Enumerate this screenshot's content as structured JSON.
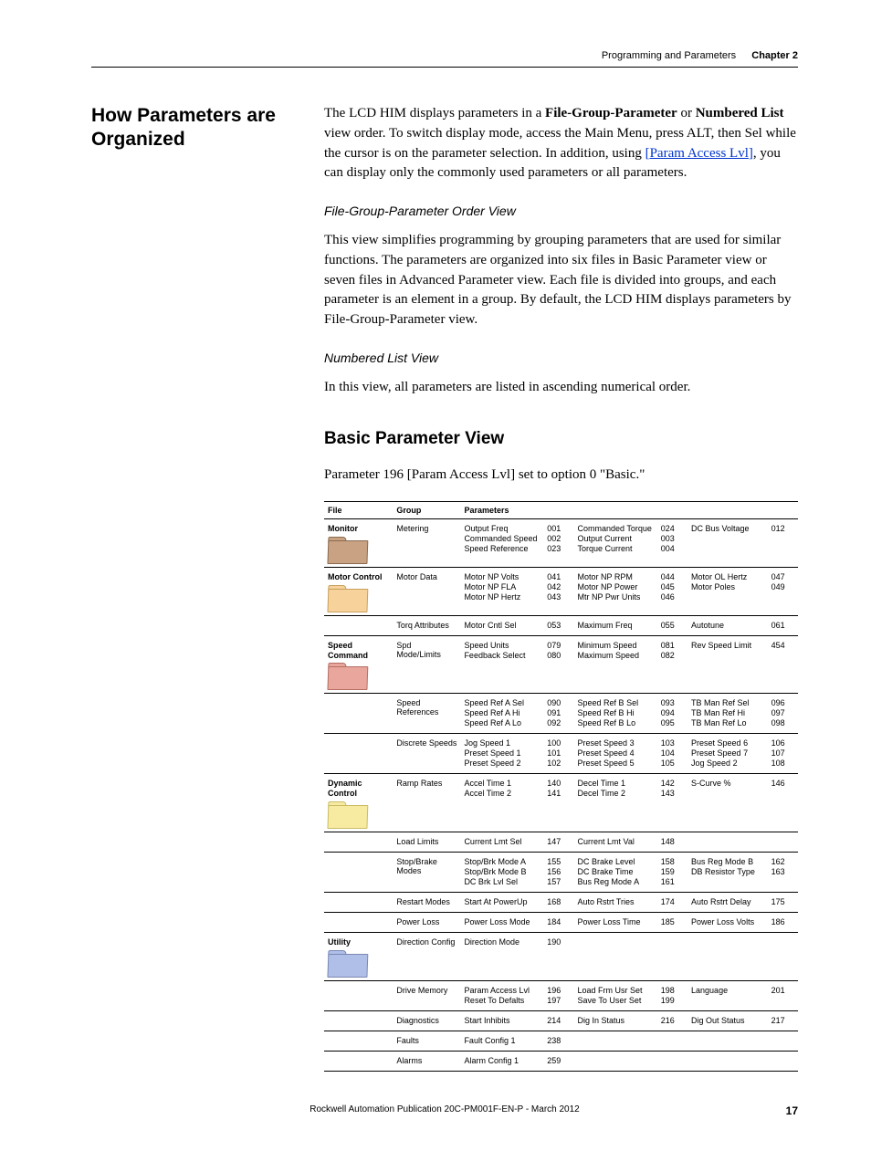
{
  "header": {
    "left": "Programming and Parameters",
    "chapter": "Chapter 2"
  },
  "section_heading": "How Parameters are Organized",
  "intro": {
    "p1a": "The LCD HIM displays parameters in a ",
    "p1_bold1": "File-Group-Parameter",
    "p1b": " or ",
    "p1_bold2": "Numbered List",
    "p1c": " view order. To switch display mode, access the Main Menu, press ALT, then Sel while the cursor is on the parameter selection. In addition, using ",
    "p1_link": "[Param Access Lvl]",
    "p1d": ", you can display only the commonly used parameters or all parameters."
  },
  "sub1_heading": "File-Group-Parameter Order View",
  "sub1_body": "This view simplifies programming by grouping parameters that are used for similar functions. The parameters are organized into six files in Basic Parameter view or seven files in Advanced Parameter view. Each file is divided into groups, and each parameter is an element in a group. By default, the LCD HIM displays parameters by File-Group-Parameter view.",
  "sub2_heading": "Numbered List View",
  "sub2_body": "In this view, all parameters are listed in ascending numerical order.",
  "basic_heading": "Basic Parameter View",
  "basic_caption": "Parameter 196 [Param Access Lvl] set to option 0 \"Basic.\"",
  "table": {
    "headers": {
      "file": "File",
      "group": "Group",
      "params": "Parameters"
    },
    "rows": [
      {
        "sep": "file",
        "file": "Monitor",
        "folder": "f-monitor",
        "group": "Metering",
        "c1": [
          [
            "Output Freq",
            "001"
          ],
          [
            "Commanded Speed",
            "002"
          ],
          [
            "Speed Reference",
            "023"
          ]
        ],
        "c2": [
          [
            "Commanded Torque",
            "024"
          ],
          [
            "Output Current",
            "003"
          ],
          [
            "Torque Current",
            "004"
          ]
        ],
        "c3": [
          [
            "DC Bus Voltage",
            "012"
          ]
        ]
      },
      {
        "sep": "file",
        "file": "Motor Control",
        "folder": "f-motor",
        "group": "Motor Data",
        "c1": [
          [
            "Motor NP Volts",
            "041"
          ],
          [
            "Motor NP FLA",
            "042"
          ],
          [
            "Motor NP Hertz",
            "043"
          ]
        ],
        "c2": [
          [
            "Motor NP RPM",
            "044"
          ],
          [
            "Motor NP Power",
            "045"
          ],
          [
            "Mtr NP Pwr Units",
            "046"
          ]
        ],
        "c3": [
          [
            "Motor OL Hertz",
            "047"
          ],
          [
            "Motor Poles",
            "049"
          ]
        ]
      },
      {
        "sep": "group",
        "file": "",
        "folder": "",
        "group": "Torq Attributes",
        "c1": [
          [
            "Motor Cntl Sel",
            "053"
          ]
        ],
        "c2": [
          [
            "Maximum Freq",
            "055"
          ]
        ],
        "c3": [
          [
            "Autotune",
            "061"
          ]
        ]
      },
      {
        "sep": "file",
        "file": "Speed Command",
        "folder": "f-speed",
        "group": "Spd Mode/Limits",
        "c1": [
          [
            "Speed Units",
            "079"
          ],
          [
            "Feedback Select",
            "080"
          ]
        ],
        "c2": [
          [
            "Minimum Speed",
            "081"
          ],
          [
            "Maximum Speed",
            "082"
          ]
        ],
        "c3": [
          [
            "Rev Speed Limit",
            "454"
          ]
        ]
      },
      {
        "sep": "group",
        "file": "",
        "folder": "",
        "group": "Speed References",
        "c1": [
          [
            "Speed Ref A Sel",
            "090"
          ],
          [
            "Speed Ref A Hi",
            "091"
          ],
          [
            "Speed Ref A Lo",
            "092"
          ]
        ],
        "c2": [
          [
            "Speed Ref B Sel",
            "093"
          ],
          [
            "Speed Ref B Hi",
            "094"
          ],
          [
            "Speed Ref B Lo",
            "095"
          ]
        ],
        "c3": [
          [
            "TB Man Ref Sel",
            "096"
          ],
          [
            "TB Man Ref Hi",
            "097"
          ],
          [
            "TB Man Ref Lo",
            "098"
          ]
        ]
      },
      {
        "sep": "group",
        "file": "",
        "folder": "",
        "group": "Discrete Speeds",
        "c1": [
          [
            "Jog Speed 1",
            "100"
          ],
          [
            "Preset Speed 1",
            "101"
          ],
          [
            "Preset Speed 2",
            "102"
          ]
        ],
        "c2": [
          [
            "Preset Speed 3",
            "103"
          ],
          [
            "Preset Speed 4",
            "104"
          ],
          [
            "Preset Speed 5",
            "105"
          ]
        ],
        "c3": [
          [
            "Preset Speed 6",
            "106"
          ],
          [
            "Preset Speed 7",
            "107"
          ],
          [
            "Jog Speed 2",
            "108"
          ]
        ]
      },
      {
        "sep": "file",
        "file": "Dynamic Control",
        "folder": "f-dyn",
        "group": "Ramp Rates",
        "c1": [
          [
            "Accel Time 1",
            "140"
          ],
          [
            "Accel Time 2",
            "141"
          ]
        ],
        "c2": [
          [
            "Decel Time 1",
            "142"
          ],
          [
            "Decel Time 2",
            "143"
          ]
        ],
        "c3": [
          [
            "S-Curve %",
            "146"
          ]
        ]
      },
      {
        "sep": "group",
        "file": "",
        "folder": "",
        "group": "Load Limits",
        "c1": [
          [
            "Current Lmt Sel",
            "147"
          ]
        ],
        "c2": [
          [
            "Current Lmt Val",
            "148"
          ]
        ],
        "c3": []
      },
      {
        "sep": "group",
        "file": "",
        "folder": "",
        "group": "Stop/Brake Modes",
        "c1": [
          [
            "Stop/Brk Mode A",
            "155"
          ],
          [
            "Stop/Brk Mode B",
            "156"
          ],
          [
            "DC Brk Lvl Sel",
            "157"
          ]
        ],
        "c2": [
          [
            "DC Brake Level",
            "158"
          ],
          [
            "DC Brake Time",
            "159"
          ],
          [
            "Bus Reg Mode A",
            "161"
          ]
        ],
        "c3": [
          [
            "Bus Reg Mode B",
            "162"
          ],
          [
            "DB Resistor Type",
            "163"
          ]
        ]
      },
      {
        "sep": "group",
        "file": "",
        "folder": "",
        "group": "Restart Modes",
        "c1": [
          [
            "Start At PowerUp",
            "168"
          ]
        ],
        "c2": [
          [
            "Auto Rstrt Tries",
            "174"
          ]
        ],
        "c3": [
          [
            "Auto Rstrt Delay",
            "175"
          ]
        ]
      },
      {
        "sep": "group",
        "file": "",
        "folder": "",
        "group": "Power Loss",
        "c1": [
          [
            "Power Loss Mode",
            "184"
          ]
        ],
        "c2": [
          [
            "Power Loss Time",
            "185"
          ]
        ],
        "c3": [
          [
            "Power Loss Volts",
            "186"
          ]
        ]
      },
      {
        "sep": "file",
        "file": "Utility",
        "folder": "f-util",
        "group": "Direction Config",
        "c1": [
          [
            "Direction Mode",
            "190"
          ]
        ],
        "c2": [],
        "c3": []
      },
      {
        "sep": "group",
        "file": "",
        "folder": "",
        "group": "Drive Memory",
        "c1": [
          [
            "Param Access Lvl",
            "196"
          ],
          [
            "Reset To Defalts",
            "197"
          ]
        ],
        "c2": [
          [
            "Load Frm Usr Set",
            "198"
          ],
          [
            "Save To User Set",
            "199"
          ]
        ],
        "c3": [
          [
            "Language",
            "201"
          ]
        ]
      },
      {
        "sep": "group",
        "file": "",
        "folder": "",
        "group": "Diagnostics",
        "c1": [
          [
            "Start Inhibits",
            "214"
          ]
        ],
        "c2": [
          [
            "Dig In Status",
            "216"
          ]
        ],
        "c3": [
          [
            "Dig Out Status",
            "217"
          ]
        ]
      },
      {
        "sep": "group",
        "file": "",
        "folder": "",
        "group": "Faults",
        "c1": [
          [
            "Fault Config 1",
            "238"
          ]
        ],
        "c2": [],
        "c3": []
      },
      {
        "sep": "group",
        "last": true,
        "file": "",
        "folder": "",
        "group": "Alarms",
        "c1": [
          [
            "Alarm Config 1",
            "259"
          ]
        ],
        "c2": [],
        "c3": []
      }
    ]
  },
  "footer": {
    "text": "Rockwell Automation Publication 20C-PM001F-EN-P - March 2012",
    "page": "17"
  }
}
